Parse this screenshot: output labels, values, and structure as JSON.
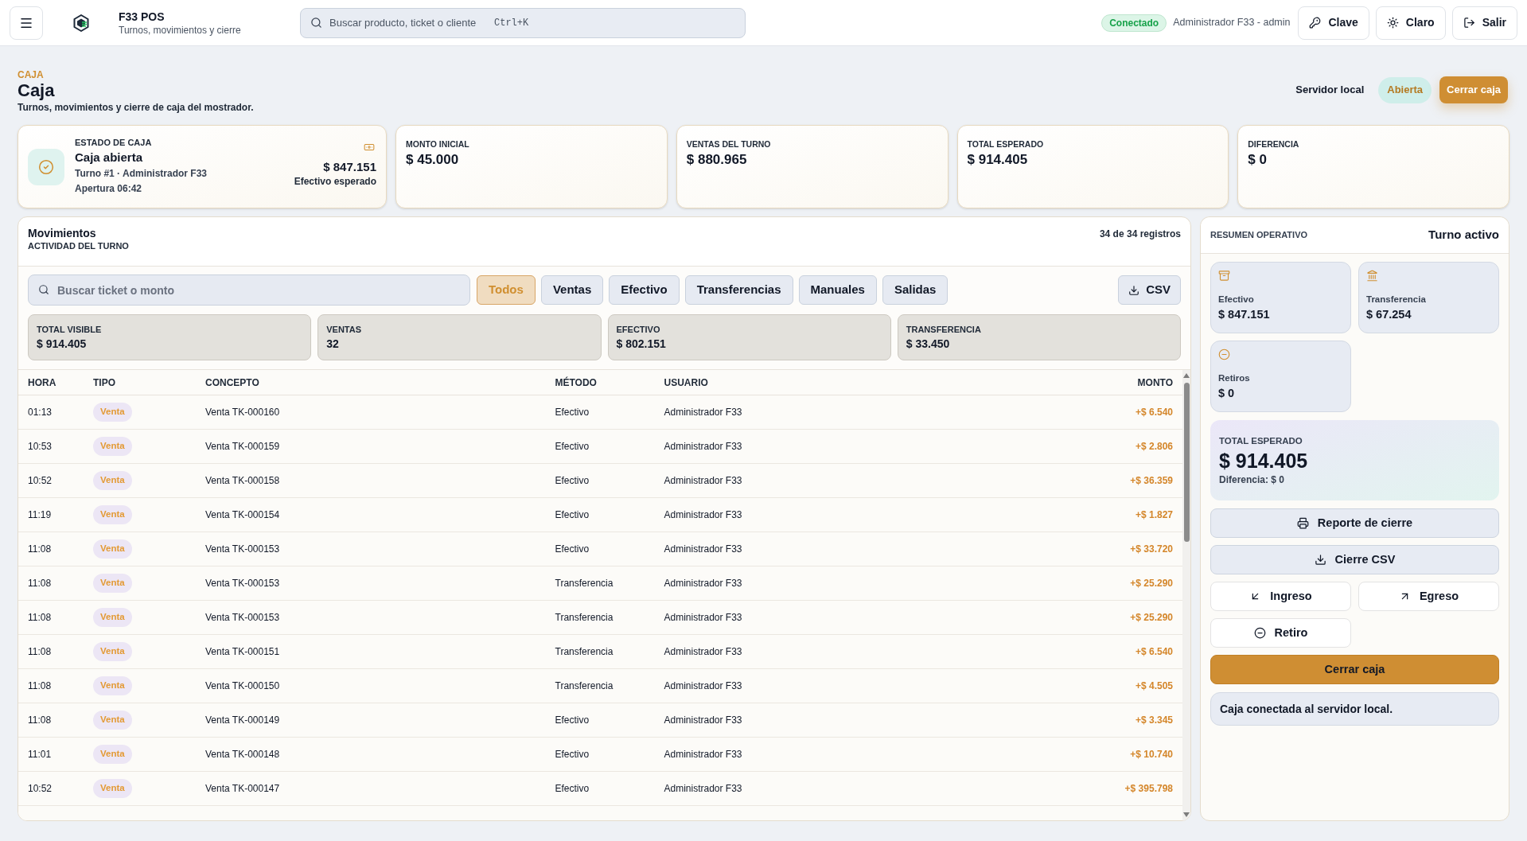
{
  "top_bar": {
    "app_title": "F33 POS",
    "app_subtitle": "Turnos, movimientos y cierre",
    "search": {
      "placeholder": "Buscar producto, ticket o cliente",
      "shortcut": "Ctrl+K"
    },
    "connection_badge": "Conectado",
    "user": "Administrador F33 - admin",
    "buttons": [
      {
        "label": "Clave",
        "kind": "key"
      },
      {
        "label": "Claro",
        "kind": "theme"
      },
      {
        "label": "Salir",
        "kind": "logout"
      }
    ]
  },
  "page_header": {
    "eyebrow": "CAJA",
    "title": "Caja",
    "subtitle": "Turnos, movimientos y cierre de caja del mostrador.",
    "server_label": "Servidor local",
    "status_pill": "Abierta",
    "close_button": "Cerrar caja"
  },
  "status_card": {
    "label": "ESTADO DE CAJA",
    "title": "Caja abierta",
    "line_1": "Turno #1 · Administrador F33",
    "line_2": "Apertura 06:42",
    "amount": "$ 847.151",
    "amount_label": "Efectivo esperado"
  },
  "kpis": [
    {
      "label": "MONTO INICIAL",
      "value": "$ 45.000"
    },
    {
      "label": "VENTAS DEL TURNO",
      "value": "$ 880.965"
    },
    {
      "label": "TOTAL ESPERADO",
      "value": "$ 914.405"
    },
    {
      "label": "DIFERENCIA",
      "value": "$ 0"
    }
  ],
  "movements": {
    "title": "Movimientos",
    "subtitle": "ACTIVIDAD DEL TURNO",
    "count": "34 de 34 registros",
    "search": {
      "placeholder": "Buscar ticket o monto"
    },
    "filters": [
      {
        "label": "Todos",
        "selected": true
      },
      {
        "label": "Ventas",
        "selected": false
      },
      {
        "label": "Efectivo",
        "selected": false
      },
      {
        "label": "Transferencias",
        "selected": false
      },
      {
        "label": "Manuales",
        "selected": false
      },
      {
        "label": "Salidas",
        "selected": false
      }
    ],
    "export_button": "CSV",
    "totals": [
      {
        "label": "TOTAL VISIBLE",
        "value": "$ 914.405"
      },
      {
        "label": "VENTAS",
        "value": "32"
      },
      {
        "label": "EFECTIVO",
        "value": "$ 802.151"
      },
      {
        "label": "TRANSFERENCIA",
        "value": "$ 33.450"
      }
    ],
    "table": {
      "columns": [
        "HORA",
        "TIPO",
        "CONCEPTO",
        "MÉTODO",
        "USUARIO",
        "MONTO"
      ],
      "rows": [
        {
          "hora": "01:13",
          "tipo": "Venta",
          "concepto": "Venta TK-000160",
          "metodo": "Efectivo",
          "usuario": "Administrador F33",
          "monto": "+$ 6.540"
        },
        {
          "hora": "10:53",
          "tipo": "Venta",
          "concepto": "Venta TK-000159",
          "metodo": "Efectivo",
          "usuario": "Administrador F33",
          "monto": "+$ 2.806"
        },
        {
          "hora": "10:52",
          "tipo": "Venta",
          "concepto": "Venta TK-000158",
          "metodo": "Efectivo",
          "usuario": "Administrador F33",
          "monto": "+$ 36.359"
        },
        {
          "hora": "11:19",
          "tipo": "Venta",
          "concepto": "Venta TK-000154",
          "metodo": "Efectivo",
          "usuario": "Administrador F33",
          "monto": "+$ 1.827"
        },
        {
          "hora": "11:08",
          "tipo": "Venta",
          "concepto": "Venta TK-000153",
          "metodo": "Efectivo",
          "usuario": "Administrador F33",
          "monto": "+$ 33.720"
        },
        {
          "hora": "11:08",
          "tipo": "Venta",
          "concepto": "Venta TK-000153",
          "metodo": "Transferencia",
          "usuario": "Administrador F33",
          "monto": "+$ 25.290"
        },
        {
          "hora": "11:08",
          "tipo": "Venta",
          "concepto": "Venta TK-000153",
          "metodo": "Transferencia",
          "usuario": "Administrador F33",
          "monto": "+$ 25.290"
        },
        {
          "hora": "11:08",
          "tipo": "Venta",
          "concepto": "Venta TK-000151",
          "metodo": "Transferencia",
          "usuario": "Administrador F33",
          "monto": "+$ 6.540"
        },
        {
          "hora": "11:08",
          "tipo": "Venta",
          "concepto": "Venta TK-000150",
          "metodo": "Transferencia",
          "usuario": "Administrador F33",
          "monto": "+$ 4.505"
        },
        {
          "hora": "11:08",
          "tipo": "Venta",
          "concepto": "Venta TK-000149",
          "metodo": "Efectivo",
          "usuario": "Administrador F33",
          "monto": "+$ 3.345"
        },
        {
          "hora": "11:01",
          "tipo": "Venta",
          "concepto": "Venta TK-000148",
          "metodo": "Efectivo",
          "usuario": "Administrador F33",
          "monto": "+$ 10.740"
        },
        {
          "hora": "10:52",
          "tipo": "Venta",
          "concepto": "Venta TK-000147",
          "metodo": "Efectivo",
          "usuario": "Administrador F33",
          "monto": "+$ 395.798"
        }
      ]
    }
  },
  "summary": {
    "title": "RESUMEN OPERATIVO",
    "status": "Turno activo",
    "tiles": [
      {
        "label": "Efectivo",
        "value": "$ 847.151",
        "kind": "cash"
      },
      {
        "label": "Transferencia",
        "value": "$ 67.254",
        "kind": "bank"
      },
      {
        "label": "Retiros",
        "value": "$ 0",
        "kind": "withdrawal"
      }
    ],
    "total": {
      "label": "TOTAL ESPERADO",
      "value": "$ 914.405",
      "difference": "Diferencia: $ 0"
    },
    "actions": [
      {
        "label": "Reporte de cierre",
        "kind": "print"
      },
      {
        "label": "Cierre CSV",
        "kind": "download"
      },
      {
        "label": "Ingreso",
        "kind": "in"
      },
      {
        "label": "Egreso",
        "kind": "out"
      },
      {
        "label": "Retiro",
        "kind": "withdraw"
      },
      {
        "label": "Cerrar caja",
        "kind": "close"
      }
    ],
    "message": "Caja conectada al servidor local."
  }
}
